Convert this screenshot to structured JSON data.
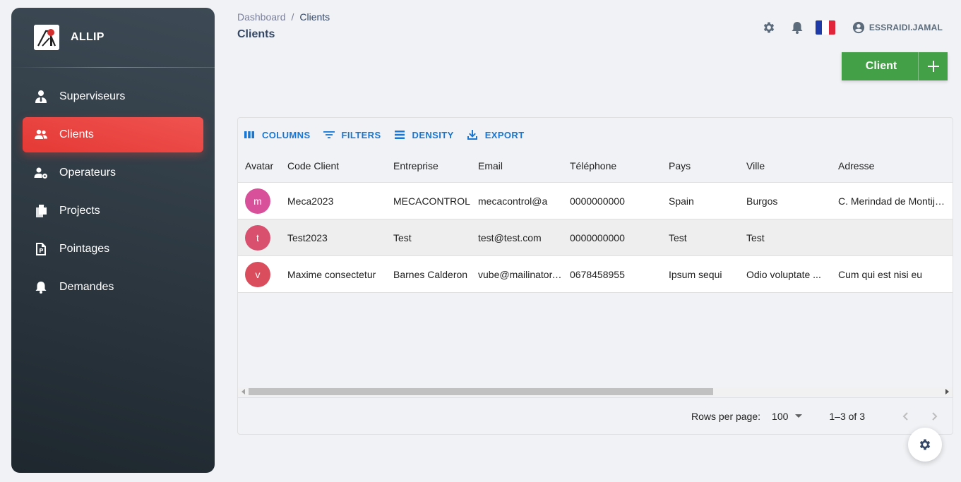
{
  "brand": {
    "name": "ALLIP",
    "logo_icon": "allip-logo-icon"
  },
  "sidebar": {
    "items": [
      {
        "label": "Superviseurs",
        "icon": "user-tie-icon",
        "active": false
      },
      {
        "label": "Clients",
        "icon": "users-icon",
        "active": true
      },
      {
        "label": "Operateurs",
        "icon": "user-gear-icon",
        "active": false
      },
      {
        "label": "Projects",
        "icon": "files-icon",
        "active": false
      },
      {
        "label": "Pointages",
        "icon": "file-p-icon",
        "active": false
      },
      {
        "label": "Demandes",
        "icon": "bell-icon",
        "active": false
      }
    ]
  },
  "header": {
    "breadcrumb": {
      "root": "Dashboard",
      "separator": "/",
      "current": "Clients"
    },
    "title": "Clients",
    "user": "ESSRAIDI.JAMAL",
    "language_flag": "french-flag"
  },
  "actions": {
    "add_label": "Client"
  },
  "toolbar": {
    "columns": "COLUMNS",
    "filters": "FILTERS",
    "density": "DENSITY",
    "export": "EXPORT"
  },
  "table": {
    "columns": [
      "Avatar",
      "Code Client",
      "Entreprise",
      "Email",
      "Téléphone",
      "Pays",
      "Ville",
      "Adresse"
    ],
    "rows": [
      {
        "avatar": "m",
        "avatar_color": "#d9509a",
        "code": "Meca2023",
        "entreprise": "MECACONTROL",
        "email": "mecacontrol@a",
        "tel": "0000000000",
        "pays": "Spain",
        "ville": "Burgos",
        "adresse": "C. Merindad de Montija, ..."
      },
      {
        "avatar": "t",
        "avatar_color": "#d9506e",
        "code": "Test2023",
        "entreprise": "Test",
        "email": "test@test.com",
        "tel": "0000000000",
        "pays": "Test",
        "ville": "Test",
        "adresse": ""
      },
      {
        "avatar": "v",
        "avatar_color": "#d94d5c",
        "code": "Maxime consectetur",
        "entreprise": "Barnes Calderon",
        "email": "vube@mailinator.com",
        "tel": "0678458955",
        "pays": "Ipsum sequi",
        "ville": "Odio voluptate ...",
        "adresse": "Cum qui est nisi eu"
      }
    ]
  },
  "pagination": {
    "rows_per_page_label": "Rows per page:",
    "rows_per_page": "100",
    "range": "1–3 of 3"
  },
  "colors": {
    "accent": "#e53935",
    "add_button": "#43a047",
    "link": "#1976d2"
  }
}
